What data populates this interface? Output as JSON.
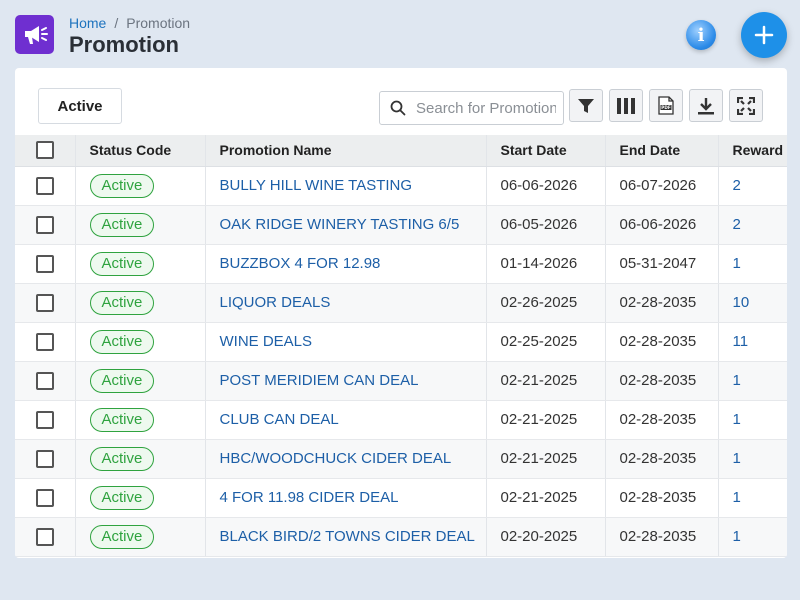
{
  "header": {
    "breadcrumb_home": "Home",
    "breadcrumb_sep": "/",
    "breadcrumb_current": "Promotion",
    "title": "Promotion",
    "app_icon": "megaphone-icon",
    "info_icon": "info-icon",
    "add_icon": "plus-icon"
  },
  "toolbar": {
    "filter_chip_label": "Active",
    "search_placeholder": "Search for Promotion",
    "buttons": [
      "filter-icon",
      "columns-icon",
      "pdf-icon",
      "download-icon",
      "fullscreen-icon"
    ],
    "pdf_label": "PDF"
  },
  "table": {
    "columns": [
      "Status Code",
      "Promotion Name",
      "Start Date",
      "End Date",
      "Reward"
    ],
    "rows": [
      {
        "status": "Active",
        "name": "BULLY HILL WINE TASTING",
        "start": "06-06-2026",
        "end": "06-07-2026",
        "reward": "2"
      },
      {
        "status": "Active",
        "name": "OAK RIDGE WINERY TASTING 6/5",
        "start": "06-05-2026",
        "end": "06-06-2026",
        "reward": "2"
      },
      {
        "status": "Active",
        "name": "BUZZBOX 4 FOR 12.98",
        "start": "01-14-2026",
        "end": "05-31-2047",
        "reward": "1"
      },
      {
        "status": "Active",
        "name": "LIQUOR DEALS",
        "start": "02-26-2025",
        "end": "02-28-2035",
        "reward": "10"
      },
      {
        "status": "Active",
        "name": "WINE DEALS",
        "start": "02-25-2025",
        "end": "02-28-2035",
        "reward": "11"
      },
      {
        "status": "Active",
        "name": "POST MERIDIEM CAN DEAL",
        "start": "02-21-2025",
        "end": "02-28-2035",
        "reward": "1"
      },
      {
        "status": "Active",
        "name": "CLUB CAN DEAL",
        "start": "02-21-2025",
        "end": "02-28-2035",
        "reward": "1"
      },
      {
        "status": "Active",
        "name": "HBC/WOODCHUCK CIDER DEAL",
        "start": "02-21-2025",
        "end": "02-28-2035",
        "reward": "1"
      },
      {
        "status": "Active",
        "name": "4 FOR 11.98 CIDER DEAL",
        "start": "02-21-2025",
        "end": "02-28-2035",
        "reward": "1"
      },
      {
        "status": "Active",
        "name": "BLACK BIRD/2 TOWNS CIDER DEAL",
        "start": "02-20-2025",
        "end": "02-28-2035",
        "reward": "1"
      }
    ]
  },
  "colors": {
    "app_icon_bg": "#6f2fd0",
    "add_button_bg": "#1e90e8",
    "status_green": "#2fa33f",
    "link_blue": "#1d5fa7"
  }
}
